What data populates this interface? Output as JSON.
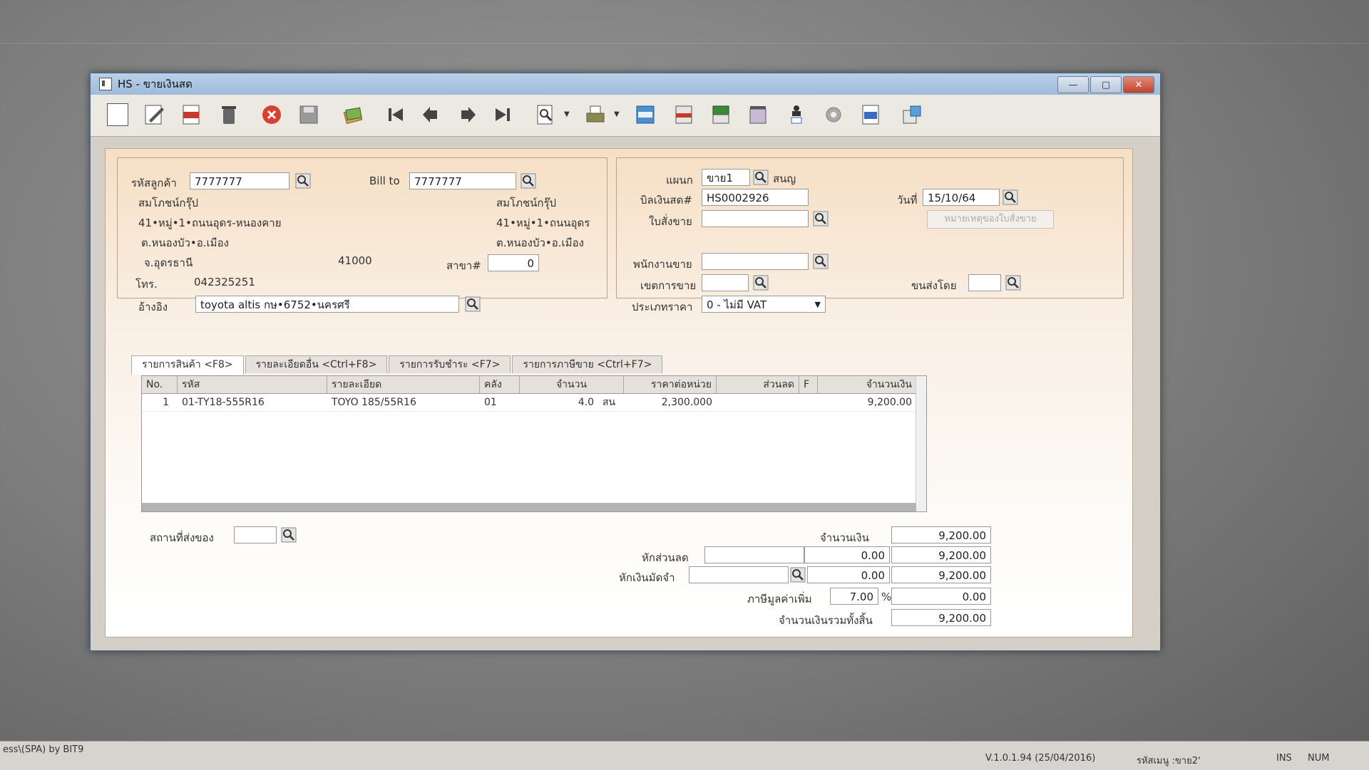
{
  "window": {
    "title": "HS - ขายเงินสด"
  },
  "customer": {
    "code_label": "รหัสลูกค้า",
    "code": "7777777",
    "name": "สมโภชน์กรุ๊ป",
    "addr1": "41•หมู่•1•ถนนอุดร-หนองคาย",
    "addr2": "ต.หนองบัว•อ.เมือง",
    "province": "จ.อุดรธานี",
    "zip": "41000",
    "phone_label": "โทร.",
    "phone": "042325251",
    "ref_label": "อ้างอิง",
    "ref": "toyota altis กษ•6752•นครศรี"
  },
  "billto": {
    "label": "Bill to",
    "code": "7777777",
    "name": "สมโภชน์กรุ๊ป",
    "addr1": "41•หมู่•1•ถนนอุดร",
    "addr2": "ต.หนองบัว•อ.เมือง",
    "branch_label": "สาขา#",
    "branch": "0"
  },
  "doc": {
    "dept_label": "แผนก",
    "dept_code": "ขาย1",
    "dept_name": "สนญ",
    "bill_label": "บิลเงินสด#",
    "bill_no": "HS0002926",
    "date_label": "วันที่",
    "date": "15/10/64",
    "so_label": "ใบสั่งขาย",
    "so_value": "",
    "so_note_button": "หมายเหตุของใบสั่งขาย",
    "salesman_label": "พนักงานขาย",
    "salesman": "",
    "area_label": "เขตการขาย",
    "area": "",
    "ship_by_label": "ขนส่งโดย",
    "ship_by": "",
    "price_type_label": "ประเภทราคา",
    "price_type": "0 - ไม่มี VAT"
  },
  "tabs": [
    {
      "label": "รายการสินค้า <F8>"
    },
    {
      "label": "รายละเอียดอื่น <Ctrl+F8>"
    },
    {
      "label": "รายการรับชำระ <F7>"
    },
    {
      "label": "รายการภาษีขาย <Ctrl+F7>"
    }
  ],
  "grid": {
    "headers": [
      "No.",
      "รหัส",
      "รายละเอียด",
      "คลัง",
      "จำนวน",
      "ราคาต่อหน่วย",
      "ส่วนลด",
      "F",
      "จำนวนเงิน"
    ],
    "rows": [
      {
        "no": "1",
        "code": "01-TY18-555R16",
        "desc": "TOYO 185/55R16",
        "wh": "01",
        "qty": "4.0",
        "unit": "สน",
        "price": "2,300.000",
        "disc": "",
        "f": "",
        "amount": "9,200.00"
      }
    ]
  },
  "ship_place_label": "สถานที่ส่งของ",
  "totals": {
    "amount_label": "จำนวนเงิน",
    "amount": "9,200.00",
    "discount_label": "หักส่วนลด",
    "discount_input": "",
    "discount": "0.00",
    "after_discount": "9,200.00",
    "deposit_label": "หักเงินมัดจำ",
    "deposit_input": "",
    "deposit": "0.00",
    "after_deposit": "9,200.00",
    "vat_label": "ภาษีมูลค่าเพิ่ม",
    "vat_rate": "7.00",
    "vat_pct": "%",
    "vat": "0.00",
    "grand_label": "จำนวนเงินรวมทั้งสิ้น",
    "grand": "9,200.00"
  },
  "statusbar": {
    "left": "ess\\(SPA) by BIT9",
    "version": "V.1.0.1.94 (25/04/2016)",
    "user": "รหัสเมนู :ขาย2'",
    "ins": "INS",
    "num": "NUM"
  }
}
